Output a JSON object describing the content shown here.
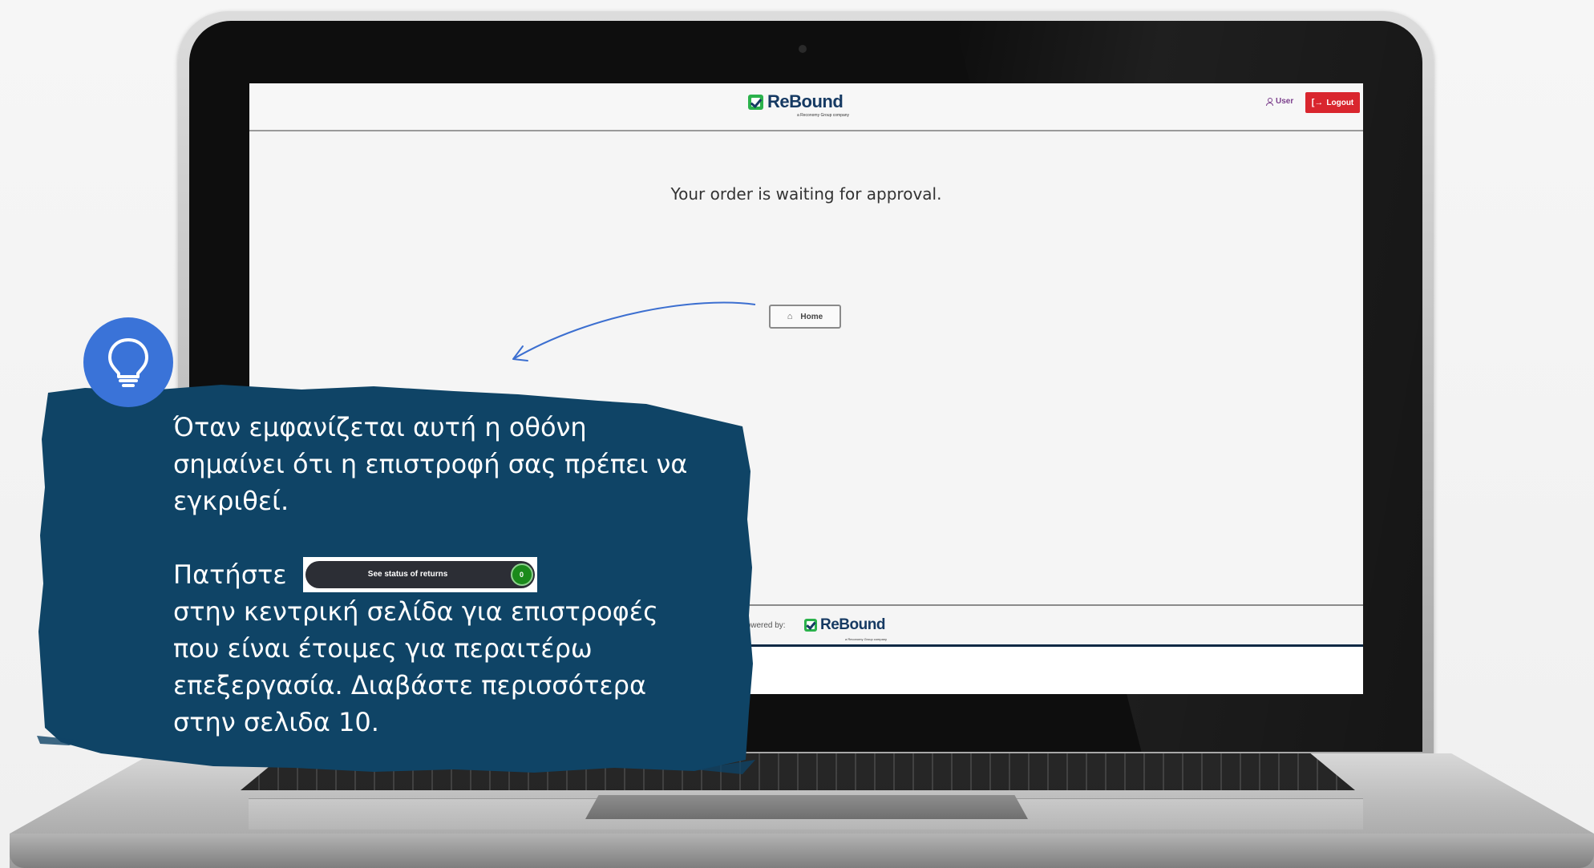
{
  "app": {
    "brand": "ReBound",
    "brand_tagline": "a Reconomy Group company",
    "header": {
      "user_label": "User",
      "logout_label": "Logout"
    },
    "main": {
      "message": "Your order is waiting for approval.",
      "home_label": "Home"
    },
    "footer": {
      "powered_by": "Powered by:",
      "brand": "ReBound",
      "brand_tagline": "a Reconomy Group company"
    }
  },
  "callout": {
    "icon": "lightbulb-icon",
    "paragraph1": "Όταν εμφανίζεται αυτή η οθόνη\nσημαίνει ότι η επιστροφή σας πρέπει να\nεγκριθεί.",
    "press_label": "Πατήστε",
    "status_button_label": "See status of returns",
    "status_count": "0",
    "paragraph2": "στην κεντρική σελίδα για επιστροφές\nπου είναι έτοιμες για περαιτέρω\nεπεξεργασία. Διαβάστε περισσότερα\nστην σελιδα 10."
  },
  "colors": {
    "callout_background": "#0f4466",
    "bulb_circle": "#3a73d8",
    "brand_navy": "#163a63",
    "brand_green": "#2bb24c",
    "logout_red": "#d9262e",
    "user_purple": "#7b3f8c",
    "status_green": "#1b8a1b"
  }
}
